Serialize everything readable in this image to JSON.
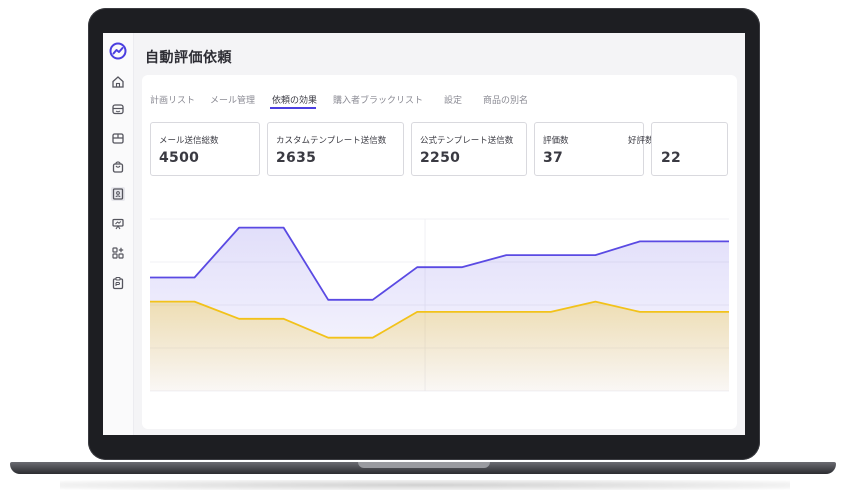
{
  "app": {
    "title": "自動評価依頼"
  },
  "sidebar": {
    "icons": [
      "logo-chart-icon",
      "home-icon",
      "store-icon",
      "box-icon",
      "shopping-bag-icon",
      "contact-card-icon",
      "presentation-icon",
      "apps-icon",
      "clipboard-icon"
    ]
  },
  "tabs": [
    {
      "label": "計画リスト",
      "active": false
    },
    {
      "label": "メール管理",
      "active": false
    },
    {
      "label": "依頼の効果",
      "active": true
    },
    {
      "label": "購入者ブラックリスト",
      "active": false
    },
    {
      "label": "設定",
      "active": false
    },
    {
      "label": "商品の別名",
      "active": false
    }
  ],
  "stats": [
    {
      "label": "メール送信総数",
      "value": "4500"
    },
    {
      "label": "カスタムテンプレート送信数",
      "value": "2635"
    },
    {
      "label": "公式テンプレート送信数",
      "value": "2250"
    },
    {
      "label": "評価数",
      "value": "37"
    },
    {
      "label": "好評数",
      "value": "22"
    }
  ],
  "colors": {
    "accent": "#4b3fe0",
    "series1": "#5a4ae3",
    "series2": "#f2c21a"
  },
  "chart_data": {
    "type": "area",
    "title": "",
    "xlabel": "",
    "ylabel": "",
    "grid": true,
    "x": [
      0,
      1,
      2,
      3,
      4,
      5,
      6,
      7,
      8,
      9,
      10,
      11,
      12,
      13
    ],
    "ylim": [
      0,
      100
    ],
    "series": [
      {
        "values": [
          66,
          66,
          95,
          95,
          53,
          53,
          72,
          72,
          79,
          79,
          79,
          87,
          87,
          87
        ]
      },
      {
        "values": [
          52,
          52,
          42,
          42,
          31,
          31,
          46,
          46,
          46,
          46,
          52,
          46,
          46,
          46
        ]
      }
    ]
  }
}
